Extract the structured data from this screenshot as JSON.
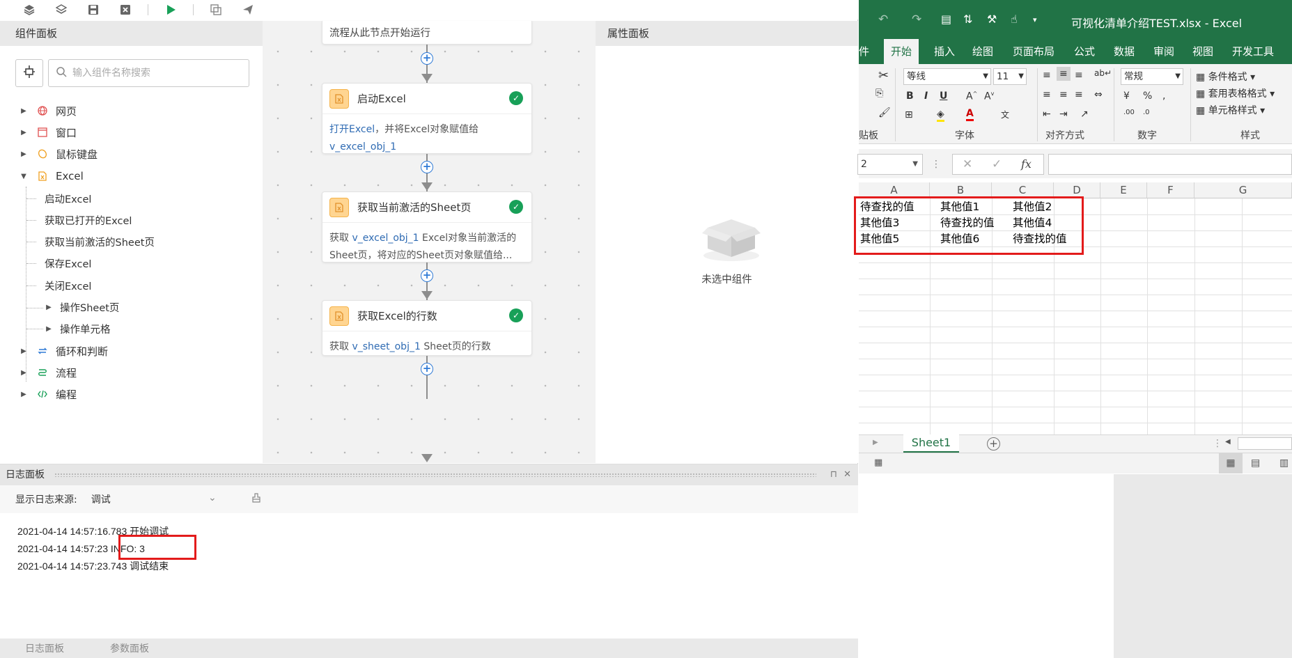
{
  "toolbar": {
    "icons": [
      "layers-up-icon",
      "layers-down-icon",
      "save-icon",
      "close-square-icon",
      "run-icon",
      "copy-window-icon",
      "send-icon"
    ]
  },
  "component_panel": {
    "title": "组件面板",
    "search_placeholder": "输入组件名称搜索",
    "tree": [
      {
        "label": "网页",
        "icon": "globe-icon",
        "expanded": false
      },
      {
        "label": "窗口",
        "icon": "window-icon",
        "expanded": false
      },
      {
        "label": "鼠标键盘",
        "icon": "mouse-keyboard-icon",
        "expanded": false
      },
      {
        "label": "Excel",
        "icon": "excel-icon",
        "expanded": true,
        "children": [
          "启动Excel",
          "获取已打开的Excel",
          "获取当前激活的Sheet页",
          "保存Excel",
          "关闭Excel",
          "操作Sheet页",
          "操作单元格"
        ]
      },
      {
        "label": "循环和判断",
        "icon": "loop-icon",
        "expanded": false
      },
      {
        "label": "流程",
        "icon": "flow-icon",
        "expanded": false
      },
      {
        "label": "编程",
        "icon": "code-icon",
        "expanded": false
      }
    ]
  },
  "flow": {
    "top_node_text": "流程从此节点开始运行",
    "nodes": [
      {
        "title": "启动Excel",
        "body_prefix": "打开Excel",
        "body_rest": "，并将Excel对象赋值给",
        "body_var": "v_excel_obj_1"
      },
      {
        "title": "获取当前激活的Sheet页",
        "body_prefix": "获取 ",
        "body_var": "v_excel_obj_1",
        "body_rest": " Excel对象当前激活的",
        "body_line2": "Sheet页，将对应的Sheet页对象赋值给..."
      },
      {
        "title": "获取Excel的行数",
        "body_prefix": "获取 ",
        "body_var": "v_sheet_obj_1",
        "body_rest": " Sheet页的行数"
      }
    ]
  },
  "property_panel": {
    "title": "属性面板",
    "empty_text": "未选中组件"
  },
  "log_panel": {
    "title": "日志面板",
    "source_label": "显示日志来源:",
    "source_value": "调试",
    "lines": [
      "2021-04-14 14:57:16.783 开始调试",
      "2021-04-14 14:57:23 INFO: 3",
      "2021-04-14 14:57:23.743 调试结束"
    ],
    "bottom_tabs": [
      "日志面板",
      "参数面板"
    ]
  },
  "excel": {
    "title": "可视化清单介绍TEST.xlsx  -  Excel",
    "tabs": [
      "件",
      "开始",
      "插入",
      "绘图",
      "页面布局",
      "公式",
      "数据",
      "审阅",
      "视图",
      "开发工具"
    ],
    "active_tab": "开始",
    "font_name": "等线",
    "font_size": "11",
    "number_format": "常规",
    "styles": [
      "条件格式",
      "套用表格格式",
      "单元格样式"
    ],
    "groups": [
      "贴板",
      "字体",
      "对齐方式",
      "数字",
      "样式"
    ],
    "name_box": "2",
    "columns": [
      "A",
      "B",
      "C",
      "D",
      "E",
      "F",
      "G"
    ],
    "rows": [
      [
        "待查找的值",
        "其他值1",
        "其他值2"
      ],
      [
        "其他值3",
        "待查找的值",
        "其他值4"
      ],
      [
        "其他值5",
        "其他值6",
        "待查找的值"
      ]
    ],
    "sheet_tab": "Sheet1"
  }
}
